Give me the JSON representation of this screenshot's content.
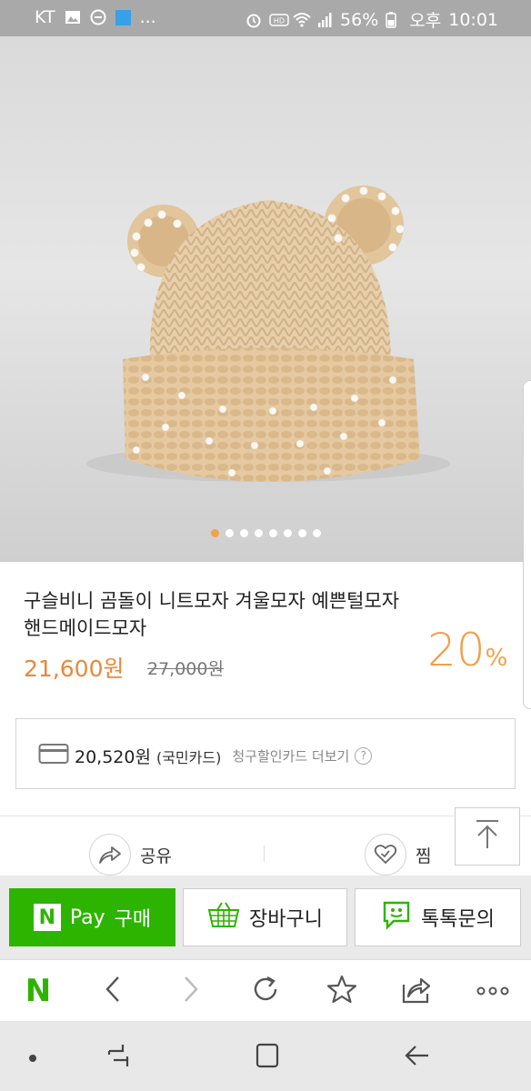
{
  "status_bar": {
    "carrier": "KT",
    "battery": "56%",
    "ampm": "오후",
    "time": "10:01",
    "more": "..."
  },
  "gallery": {
    "image_alt": "beige knit bear-ear beanie with pearls",
    "dots_count": 8,
    "active_index": 0
  },
  "product": {
    "title": "구슬비니 곰돌이 니트모자 겨울모자 예쁜털모자 핸드메이드모자",
    "price": "21,600원",
    "original_price": "27,000원",
    "discount_number": "20",
    "discount_unit": "%"
  },
  "card_discount": {
    "price": "20,520원",
    "card_name": "(국민카드)",
    "link": "청구할인카드 더보기",
    "help": "?"
  },
  "actions": {
    "share_label": "공유",
    "wish_label": "찜"
  },
  "purchase": {
    "npay_logo": "N",
    "npay_pay": "Pay",
    "npay_buy": "구매",
    "cart_label": "장바구니",
    "talk_label": "톡톡문의"
  },
  "browser": {
    "home_logo": "N"
  },
  "colors": {
    "accent_orange": "#e8893a",
    "naver_green": "#2db400",
    "status_bar": "#a9a9a9"
  }
}
